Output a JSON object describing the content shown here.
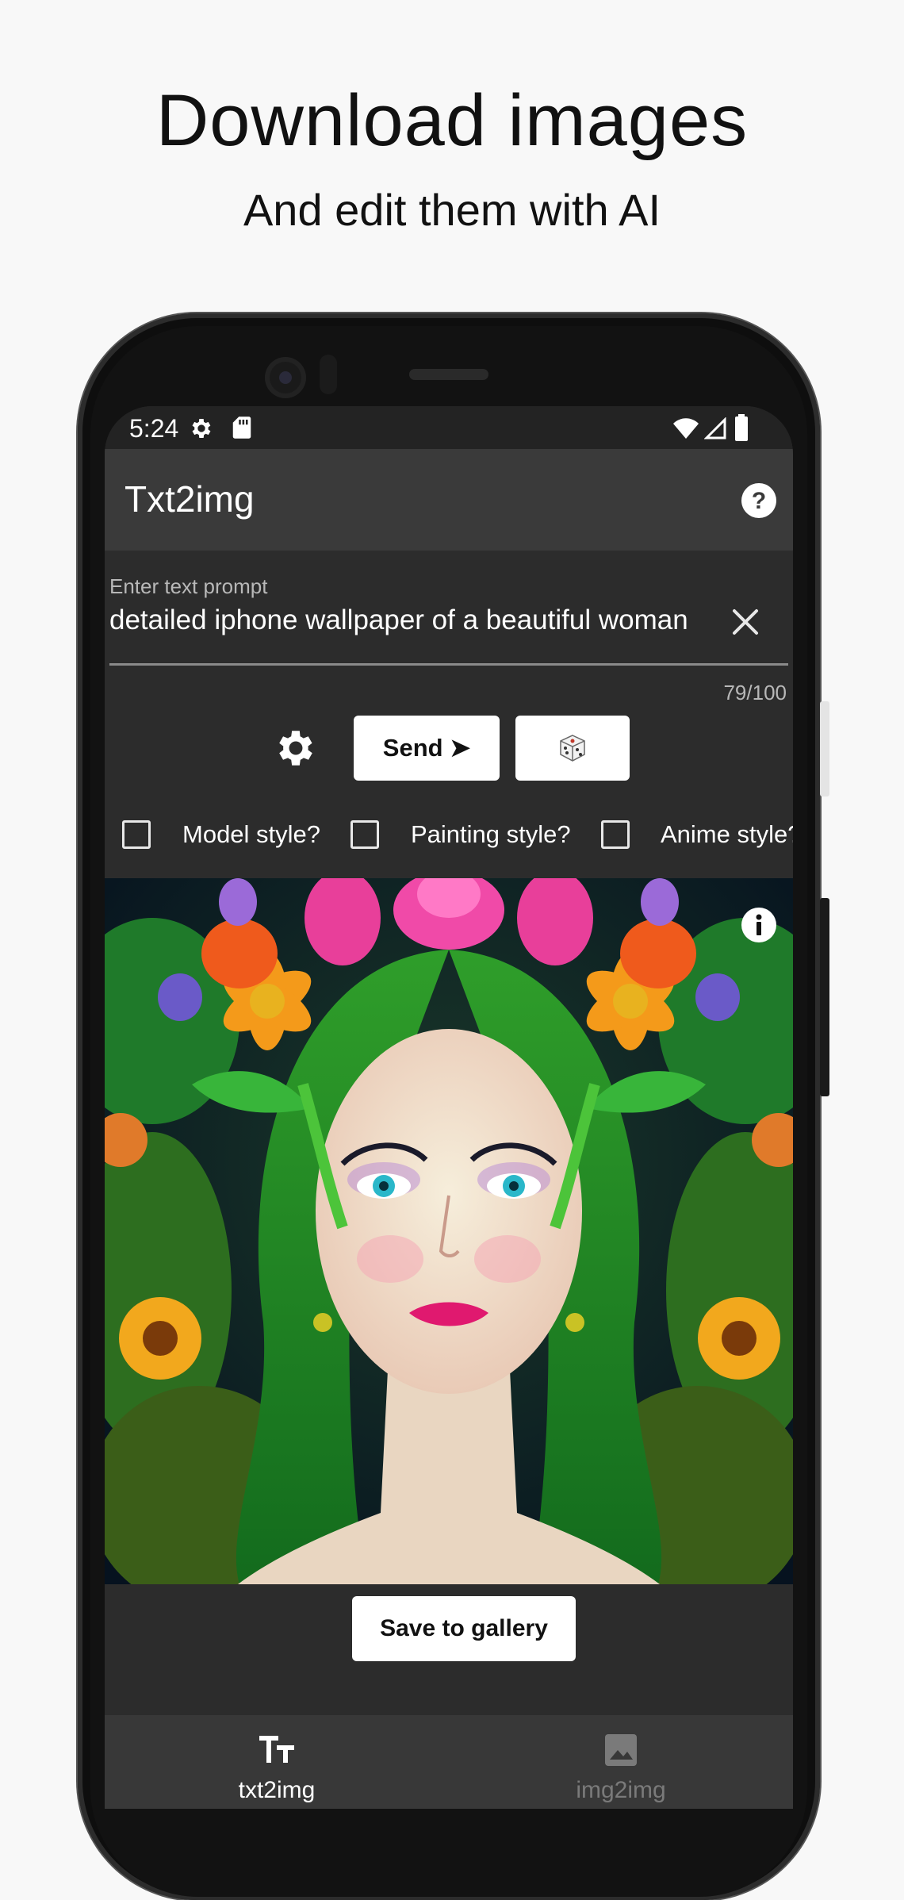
{
  "promo": {
    "headline": "Download images",
    "subline": "And edit them with AI"
  },
  "statusbar": {
    "time": "5:24",
    "icons": [
      "gear-icon",
      "sd-card-icon",
      "wifi-icon",
      "signal-icon",
      "battery-icon"
    ]
  },
  "appbar": {
    "title": "Txt2img",
    "help_icon": "help-icon"
  },
  "prompt": {
    "label": "Enter text prompt",
    "value": "detailed iphone wallpaper of a beautiful woman",
    "char_count": "79/100",
    "clear_icon": "close-icon"
  },
  "actions": {
    "settings_icon": "gear-icon",
    "send_label": "Send ➤",
    "random_icon": "dice-icon"
  },
  "styles": [
    {
      "label": "Model style?",
      "checked": false
    },
    {
      "label": "Painting style?",
      "checked": false
    },
    {
      "label": "Anime style?",
      "checked": false
    }
  ],
  "image": {
    "info_icon": "info-icon"
  },
  "save_label": "Save to gallery",
  "bottom_nav": [
    {
      "label": "txt2img",
      "icon": "text-format-icon",
      "active": true
    },
    {
      "label": "img2img",
      "icon": "image-icon",
      "active": false
    }
  ],
  "colors": {
    "screen_bg": "#2c2c2c",
    "appbar_bg": "#3a3a3a",
    "nav_active": "#ffffff",
    "nav_inactive": "#7a7a7a"
  }
}
